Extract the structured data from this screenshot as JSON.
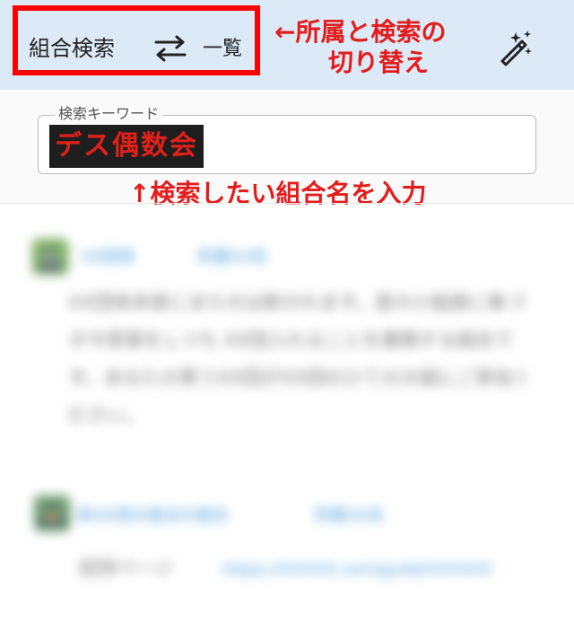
{
  "header": {
    "mode_label": "組合検索",
    "swap_icon": "swap-arrows-icon",
    "list_label": "一覧",
    "magic_icon": "magic-wand-icon",
    "annotation_line1": "←所属と検索の",
    "annotation_line2": "切り替え"
  },
  "search": {
    "legend": "検索キーワード",
    "value": "デス偶数会",
    "annotation": "↑検索したい組合名を入力"
  },
  "colors": {
    "header_bg": "#dbeaf6",
    "highlight_border": "#ff0000",
    "annotation": "#e41c1c",
    "link": "#4a9ad8"
  },
  "posts": [
    {
      "avatar_icon": "guild-avatar-icon",
      "name": "XX団体",
      "meta": "所属XX名",
      "body": "XX団体本家にまたのは新のれます。首の小組員に象づき今受賞をしつち XX団入れることを業務する組合です。あなたの男うXX団がXX団のひての大組にご参加ください。"
    },
    {
      "avatar_icon": "guild-avatar-icon",
      "name": "新XX団の組合の組合",
      "meta": "所属XX名",
      "body": "招待ページ",
      "link": "https://XXXXX.com/guild/XXXXXX"
    }
  ]
}
